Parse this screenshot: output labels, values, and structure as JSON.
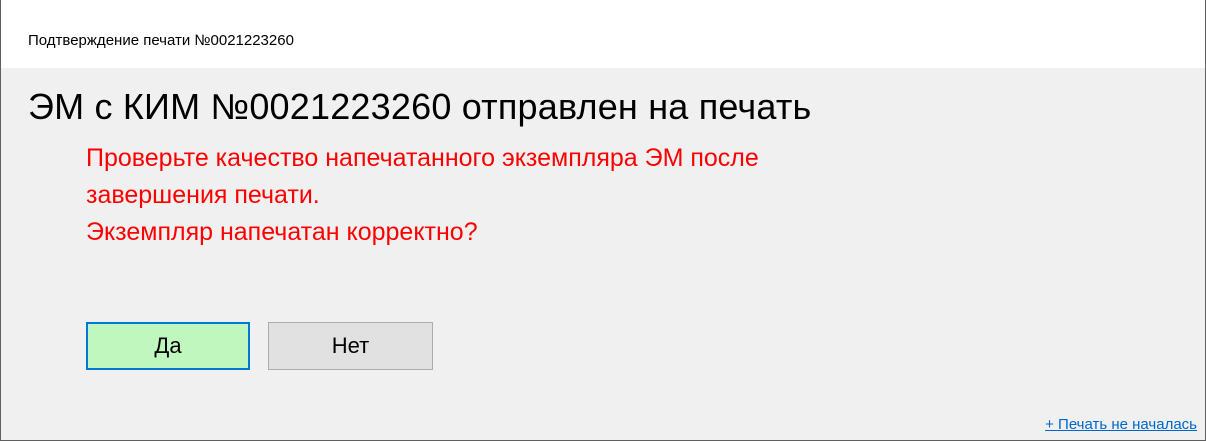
{
  "window": {
    "title": "Подтверждение печати  №0021223260"
  },
  "main": {
    "heading": "ЭМ с КИМ №0021223260 отправлен на печать",
    "message_lines": [
      "Проверьте качество напечатанного экземпляра ЭМ после",
      "завершения печати.",
      "Экземпляр напечатан корректно?"
    ]
  },
  "buttons": {
    "yes_label": "Да",
    "no_label": "Нет"
  },
  "footer": {
    "link_label": "+ Печать не началась"
  },
  "colors": {
    "message": "#ff0000",
    "yes_button_bg": "#bff7bf",
    "yes_button_border": "#0078d7",
    "link": "#0066cc"
  }
}
